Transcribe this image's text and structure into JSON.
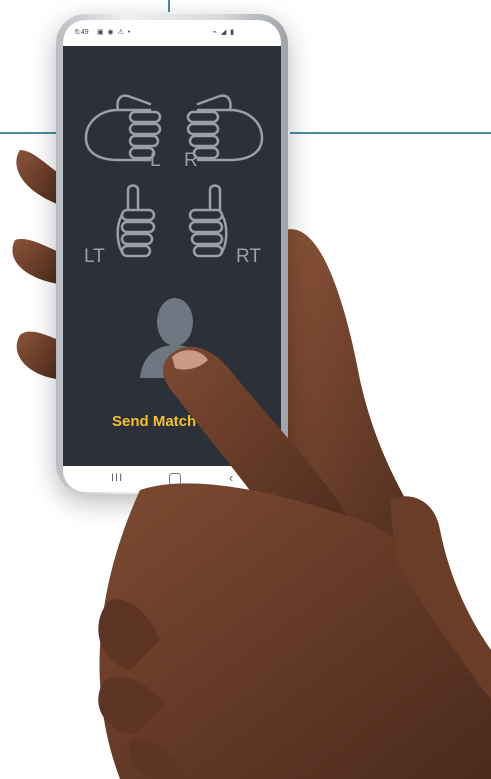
{
  "status_bar": {
    "time": "6:49",
    "left_icons": "▣ ◉ ⚠ •",
    "right_icons": "⌁ ◢ ▮"
  },
  "screen": {
    "label_left": "L",
    "label_right": "R",
    "label_left_thumb": "LT",
    "label_right_thumb": "RT",
    "send_match_label": "Send Match Q"
  },
  "nav_bar": {
    "recent": "III",
    "back": "‹"
  },
  "colors": {
    "screen_bg": "#2b3039",
    "icon_outline": "#9aa0a8",
    "button_text": "#f2c230",
    "skin_dark": "#5a3424",
    "skin_mid": "#7a4a33"
  }
}
